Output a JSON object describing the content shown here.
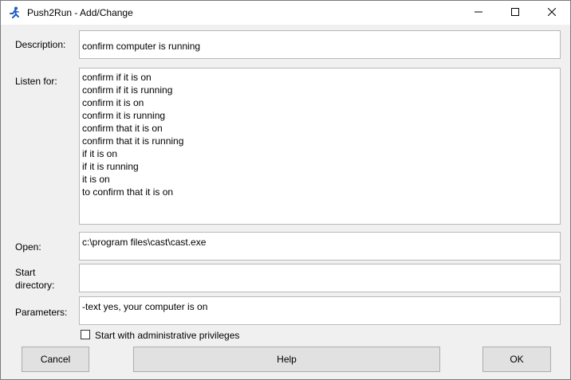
{
  "window": {
    "title": "Push2Run - Add/Change"
  },
  "form": {
    "description_label": "Description:",
    "description_value": "confirm computer is running",
    "listen_label": "Listen for:",
    "listen_lines": [
      "confirm if it is on",
      "confirm if it is running",
      "confirm it is on",
      "confirm it is running",
      "confirm that it is on",
      "confirm that it is running",
      "if it is on",
      "if it is running",
      "it is on",
      "to confirm that it is on"
    ],
    "open_label": "Open:",
    "open_value": "c:\\program files\\cast\\cast.exe",
    "start_dir_label_line1": "Start",
    "start_dir_label_line2": "directory:",
    "start_dir_value": "",
    "parameters_label": "Parameters:",
    "parameters_value": "-text yes, your computer is on",
    "admin_checkbox_label": "Start with administrative privileges",
    "admin_checked": false
  },
  "buttons": {
    "cancel": "Cancel",
    "help": "Help",
    "ok": "OK"
  },
  "icons": {
    "app": "running-person-icon",
    "minimize": "minimize-icon",
    "maximize": "maximize-icon",
    "close": "close-icon"
  },
  "colors": {
    "app_icon": "#1e5bc6",
    "dialog_bg": "#f0f0f0",
    "field_border": "#b9b9b9",
    "button_bg": "#e1e1e1"
  }
}
